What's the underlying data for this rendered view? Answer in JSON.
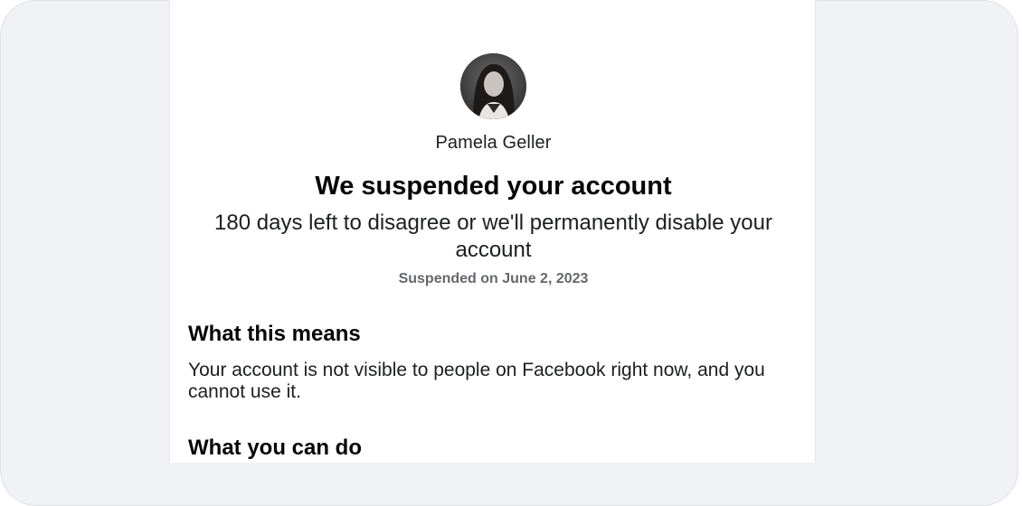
{
  "profile": {
    "name": "Pamela Geller"
  },
  "notice": {
    "title": "We suspended your account",
    "subtitle": "180 days left to disagree or we'll permanently disable your account",
    "suspended_date": "Suspended on June 2, 2023"
  },
  "sections": [
    {
      "heading": "What this means",
      "body": "Your account is not visible to people on Facebook right now, and you cannot use it."
    },
    {
      "heading": "What you can do"
    }
  ],
  "colors": {
    "background": "#f0f2f5",
    "card": "#ffffff",
    "text_primary": "#050505",
    "text_secondary": "#65676b"
  }
}
